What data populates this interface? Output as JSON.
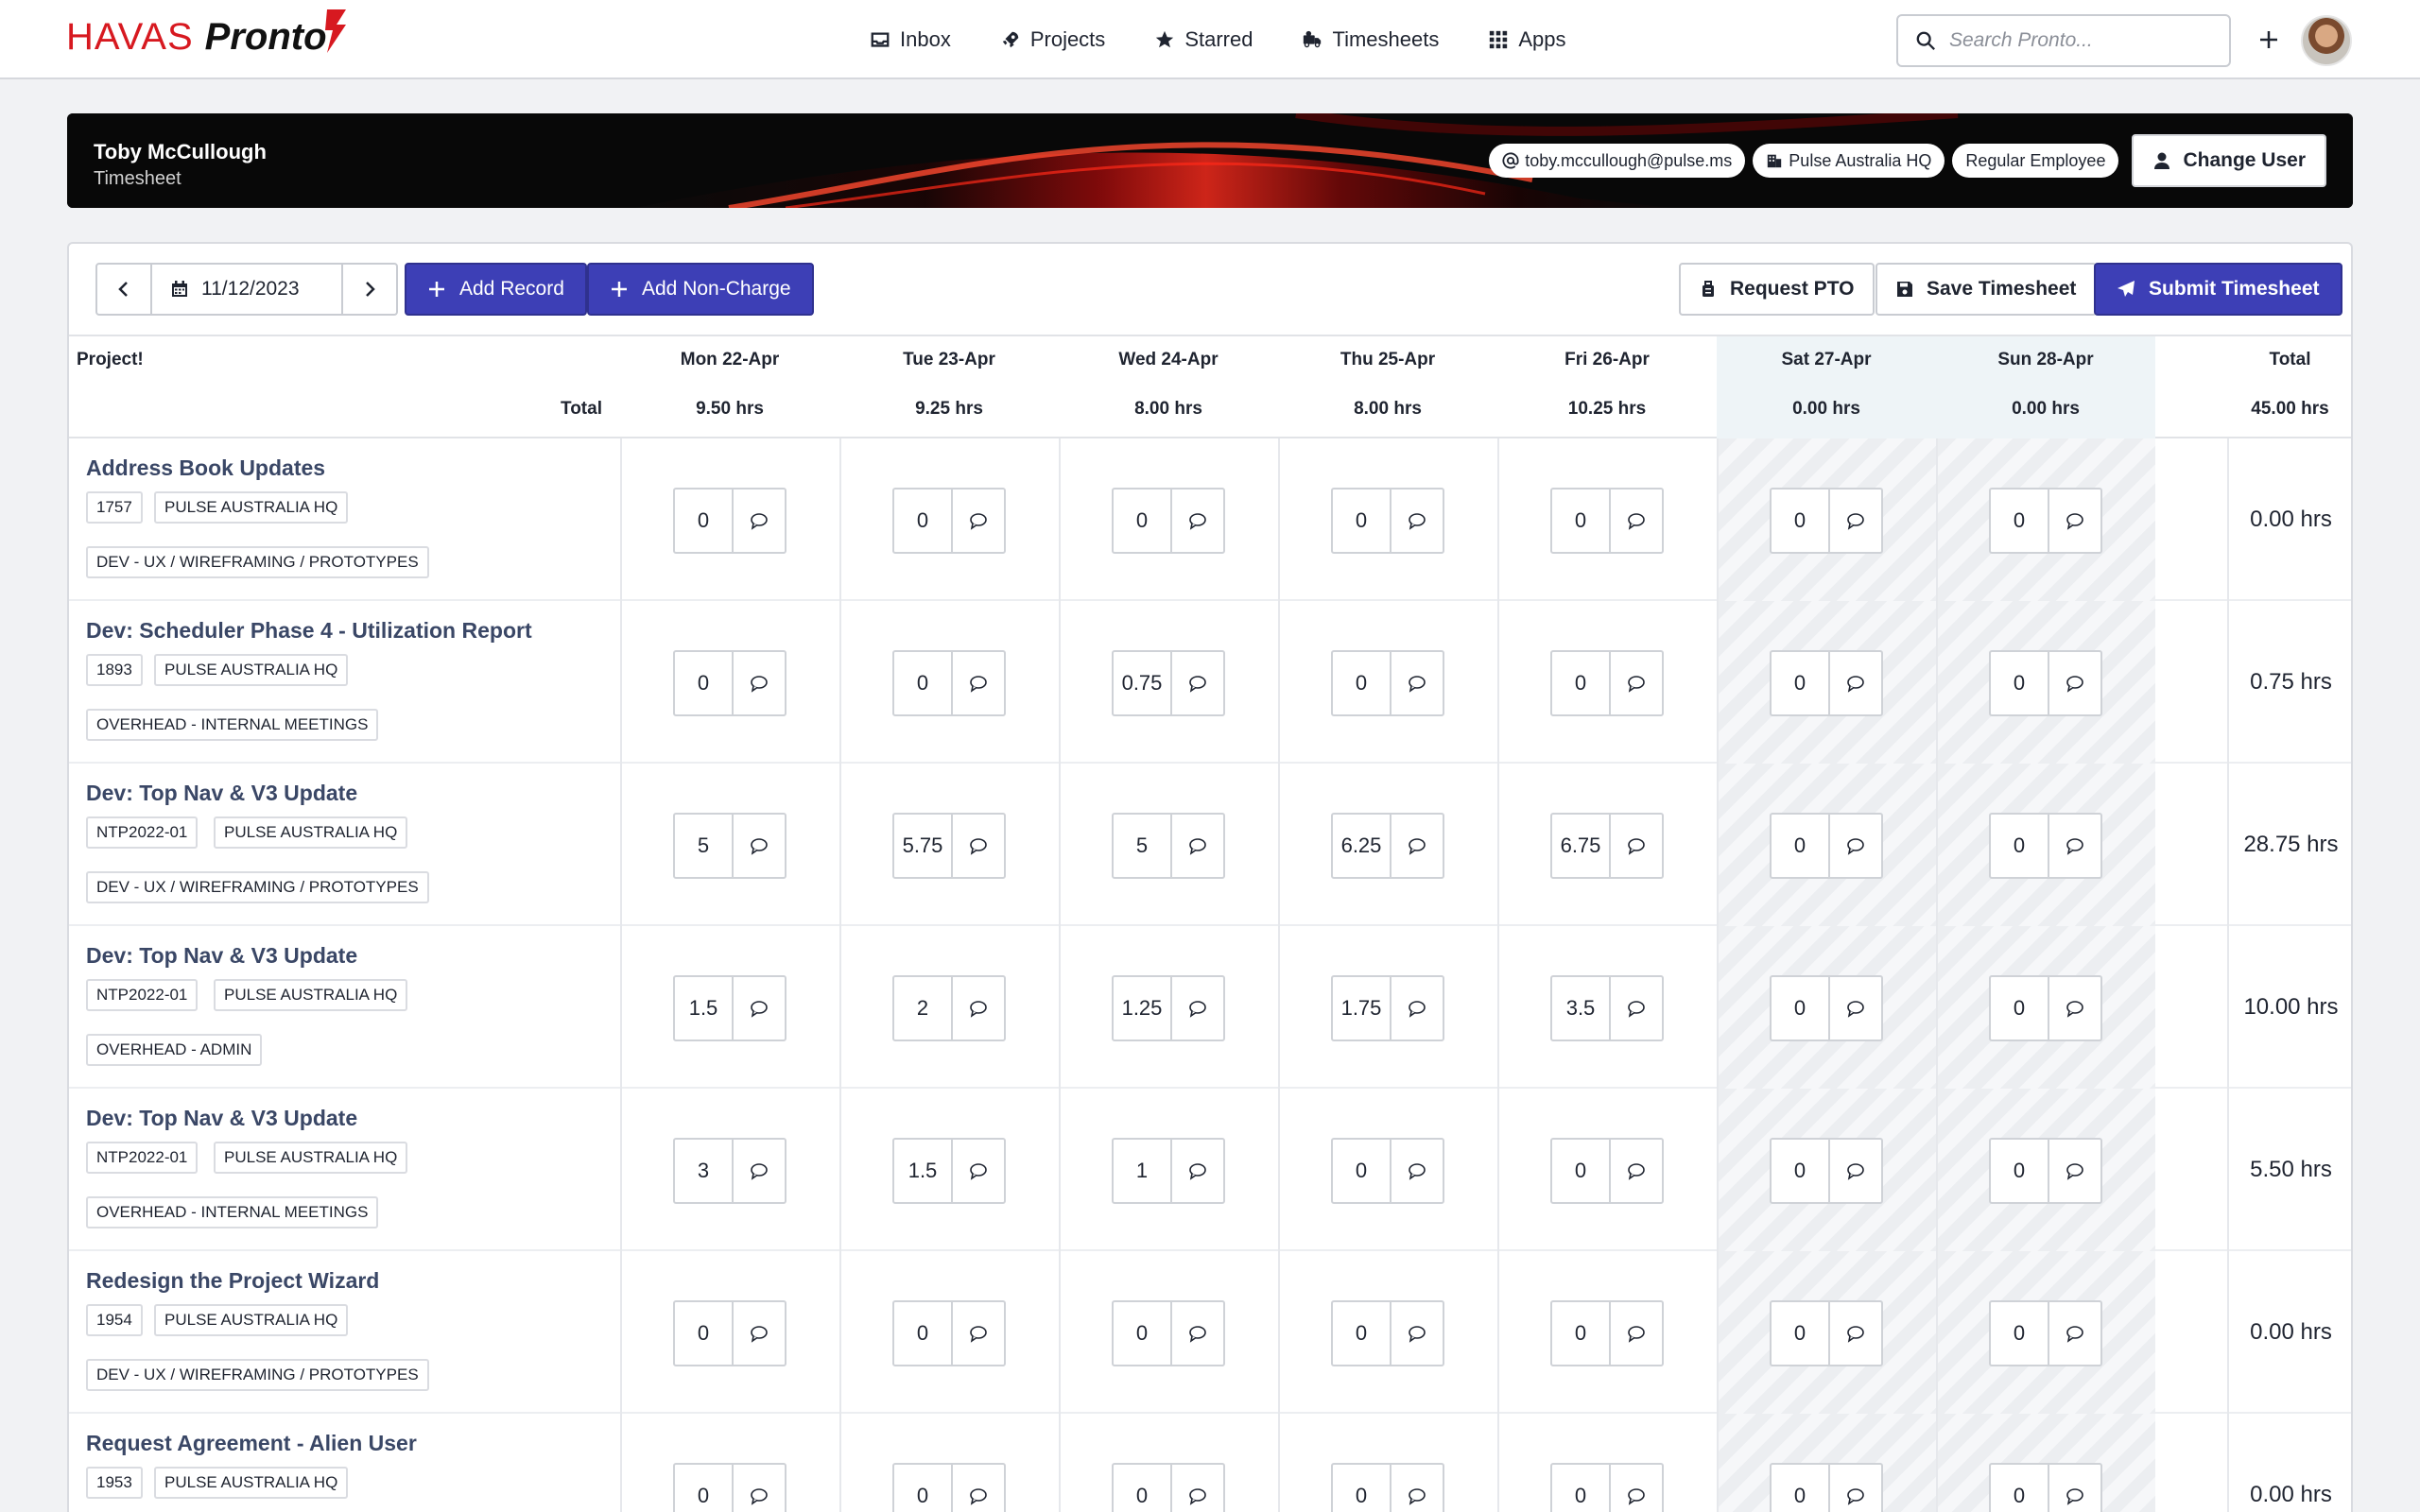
{
  "brand": {
    "havas": "HAVAS",
    "pronto": "Pronto"
  },
  "nav": [
    {
      "label": "Inbox",
      "icon": "inbox-icon"
    },
    {
      "label": "Projects",
      "icon": "rocket-icon"
    },
    {
      "label": "Starred",
      "icon": "star-icon"
    },
    {
      "label": "Timesheets",
      "icon": "truck-clock-icon"
    },
    {
      "label": "Apps",
      "icon": "grid-icon"
    }
  ],
  "search": {
    "placeholder": "Search Pronto..."
  },
  "banner": {
    "name": "Toby McCullough",
    "subtitle": "Timesheet",
    "email": "toby.mccullough@pulse.ms",
    "office": "Pulse Australia HQ",
    "employment": "Regular Employee",
    "change_user": "Change User"
  },
  "toolbar": {
    "date": "11/12/2023",
    "add_record": "Add Record",
    "add_non_charge": "Add Non-Charge",
    "request_pto": "Request PTO",
    "save_timesheet": "Save Timesheet",
    "submit_timesheet": "Submit Timesheet"
  },
  "table": {
    "project_header": "Project!",
    "total_label": "Total",
    "days": [
      {
        "label": "Mon 22-Apr",
        "total": "9.50 hrs",
        "weekend": false
      },
      {
        "label": "Tue 23-Apr",
        "total": "9.25 hrs",
        "weekend": false
      },
      {
        "label": "Wed 24-Apr",
        "total": "8.00 hrs",
        "weekend": false
      },
      {
        "label": "Thu 25-Apr",
        "total": "8.00 hrs",
        "weekend": false
      },
      {
        "label": "Fri 26-Apr",
        "total": "10.25 hrs",
        "weekend": false
      },
      {
        "label": "Sat 27-Apr",
        "total": "0.00 hrs",
        "weekend": true
      },
      {
        "label": "Sun 28-Apr",
        "total": "0.00 hrs",
        "weekend": true
      }
    ],
    "total_header": "Total",
    "grand_total": "45.00 hrs",
    "rows": [
      {
        "title": "Address Book Updates",
        "code": "1757",
        "office": "PULSE AUSTRALIA HQ",
        "task": "DEV - UX / WIREFRAMING / PROTOTYPES",
        "hours": [
          "0",
          "0",
          "0",
          "0",
          "0",
          "0",
          "0"
        ],
        "total": "0.00 hrs"
      },
      {
        "title": "Dev: Scheduler Phase 4 - Utilization Report",
        "code": "1893",
        "office": "PULSE AUSTRALIA HQ",
        "task": "OVERHEAD - INTERNAL MEETINGS",
        "hours": [
          "0",
          "0",
          "0.75",
          "0",
          "0",
          "0",
          "0"
        ],
        "total": "0.75 hrs"
      },
      {
        "title": "Dev: Top Nav & V3 Update",
        "code": "NTP2022-01",
        "office": "PULSE AUSTRALIA HQ",
        "task": "DEV - UX / WIREFRAMING / PROTOTYPES",
        "hours": [
          "5",
          "5.75",
          "5",
          "6.25",
          "6.75",
          "0",
          "0"
        ],
        "total": "28.75 hrs"
      },
      {
        "title": "Dev: Top Nav & V3 Update",
        "code": "NTP2022-01",
        "office": "PULSE AUSTRALIA HQ",
        "task": "OVERHEAD - ADMIN",
        "hours": [
          "1.5",
          "2",
          "1.25",
          "1.75",
          "3.5",
          "0",
          "0"
        ],
        "total": "10.00 hrs"
      },
      {
        "title": "Dev: Top Nav & V3 Update",
        "code": "NTP2022-01",
        "office": "PULSE AUSTRALIA HQ",
        "task": "OVERHEAD - INTERNAL MEETINGS",
        "hours": [
          "3",
          "1.5",
          "1",
          "0",
          "0",
          "0",
          "0"
        ],
        "total": "5.50 hrs"
      },
      {
        "title": "Redesign the Project Wizard",
        "code": "1954",
        "office": "PULSE AUSTRALIA HQ",
        "task": "DEV - UX / WIREFRAMING / PROTOTYPES",
        "hours": [
          "0",
          "0",
          "0",
          "0",
          "0",
          "0",
          "0"
        ],
        "total": "0.00 hrs"
      },
      {
        "title": "Request Agreement - Alien User",
        "code": "1953",
        "office": "PULSE AUSTRALIA HQ",
        "task": "",
        "hours": [
          "0",
          "0",
          "0",
          "0",
          "0",
          "0",
          "0"
        ],
        "total": "0.00 hrs"
      }
    ]
  },
  "colors": {
    "brand_red": "#d71920",
    "primary": "#3d3fb6",
    "project_title": "#3a4766"
  }
}
